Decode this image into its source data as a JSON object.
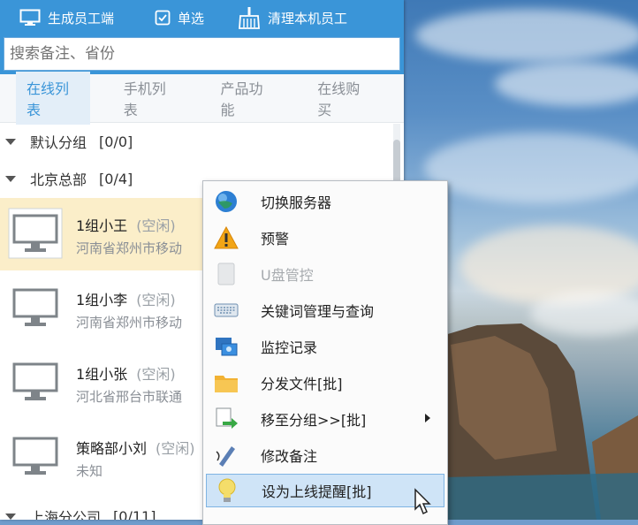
{
  "toolbar": {
    "generate_label": "生成员工端",
    "single_select_label": "单选",
    "clear_label": "清理本机员工"
  },
  "search": {
    "placeholder": "搜索备注、省份"
  },
  "tabs": [
    "在线列表",
    "手机列表",
    "产品功能",
    "在线购买"
  ],
  "groups": [
    {
      "name": "默认分组",
      "count": "[0/0]"
    },
    {
      "name": "北京总部",
      "count": "[0/4]"
    },
    {
      "name": "上海分公司",
      "count": "[0/11]"
    }
  ],
  "contacts": [
    {
      "name": "1组小王",
      "status": "(空闲)",
      "location": "河南省郑州市移动"
    },
    {
      "name": "1组小李",
      "status": "(空闲)",
      "location": "河南省郑州市移动"
    },
    {
      "name": "1组小张",
      "status": "(空闲)",
      "location": "河北省邢台市联通"
    },
    {
      "name": "策略部小刘",
      "status": "(空闲)",
      "location": "未知"
    }
  ],
  "context_menu": [
    {
      "label": "切换服务器",
      "icon": "globe-icon"
    },
    {
      "label": "预警",
      "icon": "warning-icon"
    },
    {
      "label": "U盘管控",
      "icon": "usb-drive-icon",
      "disabled": true
    },
    {
      "label": "关键词管理与查询",
      "icon": "keyboard-icon"
    },
    {
      "label": "监控记录",
      "icon": "monitor-record-icon"
    },
    {
      "label": "分发文件[批]",
      "icon": "folder-icon"
    },
    {
      "label": "移至分组>>[批]",
      "icon": "move-group-icon",
      "submenu": true
    },
    {
      "label": "修改备注",
      "icon": "edit-note-icon"
    },
    {
      "label": "设为上线提醒[批]",
      "icon": "lightbulb-icon",
      "hovered": true
    }
  ],
  "colors": {
    "accent": "#3a95d8",
    "selected_row": "#fbeec9",
    "menu_hover": "#cfe4f7"
  }
}
